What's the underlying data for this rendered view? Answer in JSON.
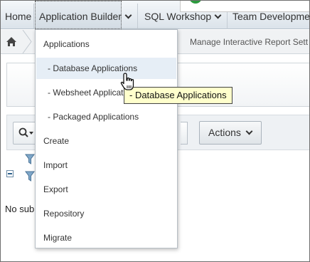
{
  "nav": {
    "tabs": [
      {
        "label": "Home"
      },
      {
        "label": "Application Builder"
      },
      {
        "label": "SQL Workshop"
      },
      {
        "label": "Team Development"
      }
    ]
  },
  "breadcrumb": {
    "home_icon": "home-icon",
    "current": "Manage Interactive Report Sett"
  },
  "toolbar": {
    "search_icon": "search-icon",
    "actions_label": "Actions"
  },
  "content": {
    "no_subscriptions_text": "No sub"
  },
  "menu": {
    "items": [
      {
        "label": "Applications"
      },
      {
        "label": "- Database Applications"
      },
      {
        "label": "- Websheet Applicat"
      },
      {
        "label": "- Packaged Applications"
      },
      {
        "label": "Create"
      },
      {
        "label": "Import"
      },
      {
        "label": "Export"
      },
      {
        "label": "Repository"
      },
      {
        "label": "Migrate"
      }
    ]
  },
  "tooltip": {
    "text": "- Database Applications"
  },
  "colors": {
    "accent": "#2c9a3e",
    "menu_hover": "#e6eef6",
    "tooltip_bg": "#ffffcc"
  }
}
